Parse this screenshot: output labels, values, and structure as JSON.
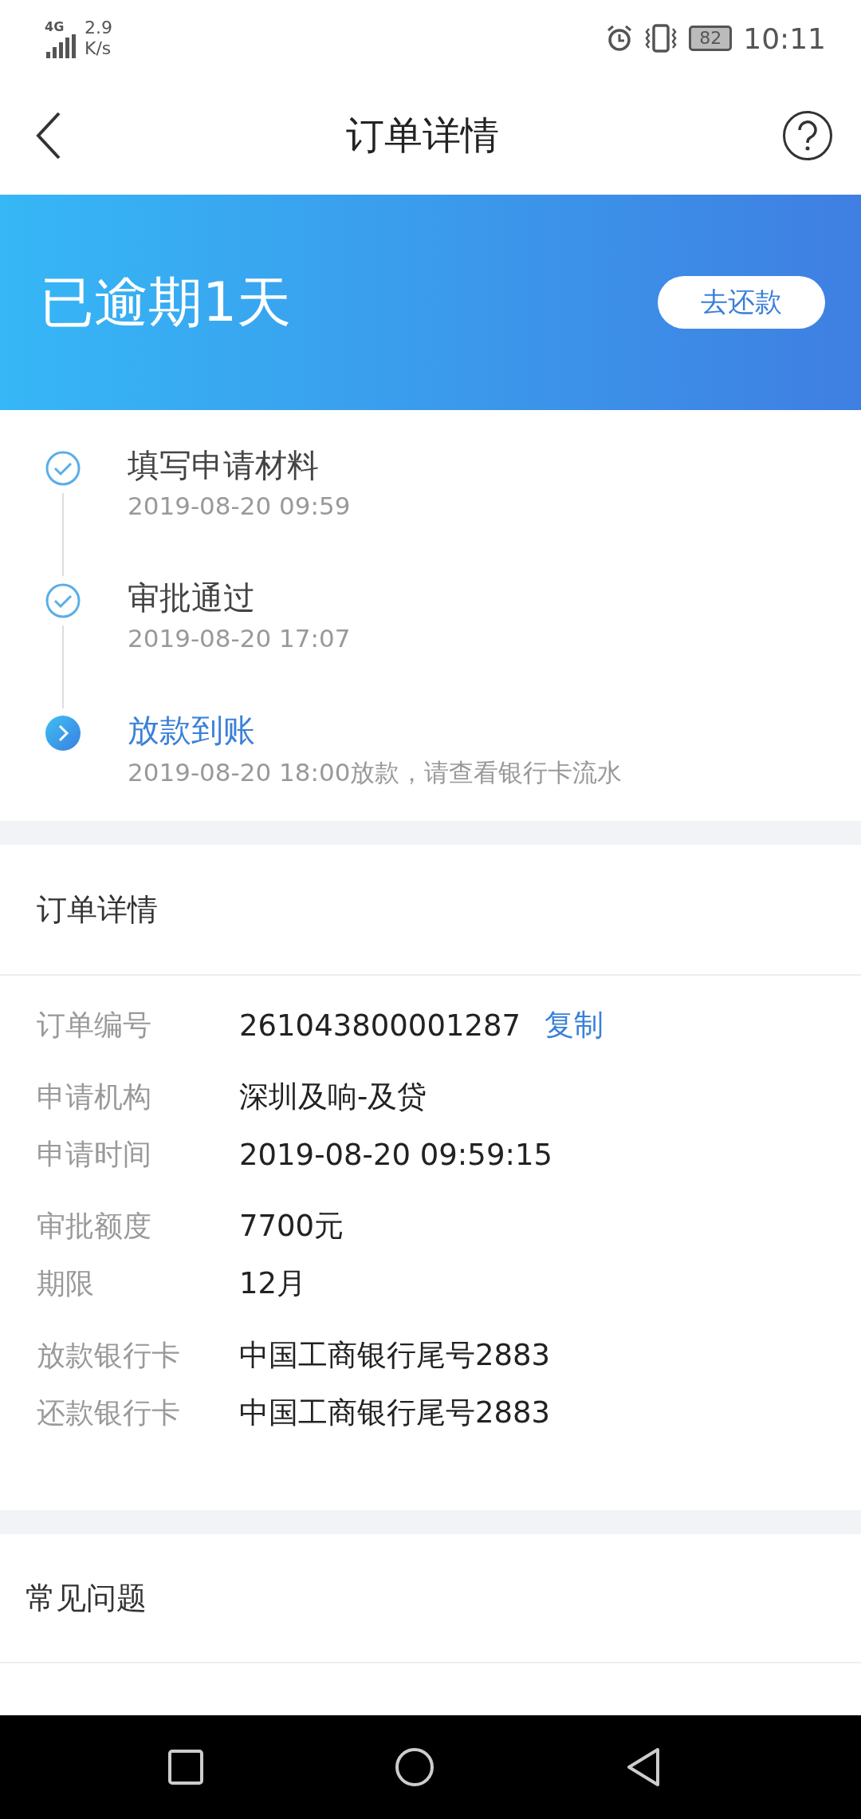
{
  "status_bar": {
    "network": "4G",
    "speed_value": "2.9",
    "speed_unit": "K/s",
    "battery": "82",
    "time": "10:11"
  },
  "header": {
    "title": "订单详情"
  },
  "banner": {
    "status": "已逾期1天",
    "button": "去还款"
  },
  "steps": [
    {
      "title": "填写申请材料",
      "detail": "2019-08-20 09:59",
      "done": true
    },
    {
      "title": "审批通过",
      "detail": "2019-08-20 17:07",
      "done": true
    },
    {
      "title": "放款到账",
      "detail": "2019-08-20 18:00放款，请查看银行卡流水",
      "done": false
    }
  ],
  "details": {
    "title": "订单详情",
    "groups": [
      [
        {
          "label": "订单编号",
          "value": "261043800001287",
          "action": "复制"
        }
      ],
      [
        {
          "label": "申请机构",
          "value": "深圳及响-及贷"
        },
        {
          "label": "申请时间",
          "value": "2019-08-20 09:59:15"
        }
      ],
      [
        {
          "label": "审批额度",
          "value": "7700元"
        },
        {
          "label": "期限",
          "value": "12月"
        }
      ],
      [
        {
          "label": "放款银行卡",
          "value": "中国工商银行尾号2883"
        },
        {
          "label": "还款银行卡",
          "value": "中国工商银行尾号2883"
        }
      ]
    ]
  },
  "faq": {
    "title": "常见问题"
  }
}
